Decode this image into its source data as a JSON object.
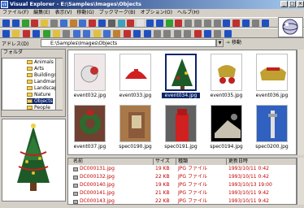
{
  "window": {
    "title": "Visual Explorer - E:\\Samples\\Images\\Objects"
  },
  "menu": [
    "ファイル(F)",
    "編集(E)",
    "表示(V)",
    "移動(G)",
    "ブックマーク(B)",
    "オプション(O)",
    "ヘルプ(H)"
  ],
  "address": {
    "label": "アドレス(D)",
    "value": "E:\\Samples\\Images\\Objects",
    "go": "移動"
  },
  "folders": {
    "header": "フォルダ",
    "items": [
      "Animals",
      "Arts",
      "Buildings",
      "Landmarks",
      "Landscapes",
      "Nature",
      "Objects",
      "People"
    ],
    "selected": "Objects"
  },
  "thumbnails": [
    {
      "name": "event032.jpg"
    },
    {
      "name": "event033.jpg"
    },
    {
      "name": "event034.jpg",
      "selected": true
    },
    {
      "name": "event035.jpg"
    },
    {
      "name": "event036.jpg"
    },
    {
      "name": "event037.jpg"
    },
    {
      "name": "spec0190.jpg"
    },
    {
      "name": "spec0191.jpg"
    },
    {
      "name": "spec0194.jpg"
    },
    {
      "name": "spec0200.jpg"
    }
  ],
  "list": {
    "headers": [
      "名前",
      "サイズ",
      "種類",
      "更新日時"
    ],
    "rows": [
      {
        "name": "DC000131.jpg",
        "size": "19 KB",
        "type": "JPG ファイル",
        "date": "1993/10/11 0:42"
      },
      {
        "name": "DC000132.jpg",
        "size": "22 KB",
        "type": "JPG ファイル",
        "date": "1993/10/11 0:42"
      },
      {
        "name": "DC000140.jpg",
        "size": "19 KB",
        "type": "JPG ファイル",
        "date": "1993/10/13 19:00"
      },
      {
        "name": "DC000141.jpg",
        "size": "21 KB",
        "type": "JPG ファイル",
        "date": "1993/10/11 9:42"
      },
      {
        "name": "DC000143.jpg",
        "size": "22 KB",
        "type": "JPG ファイル",
        "date": "1993/10/11 9:42"
      }
    ]
  }
}
